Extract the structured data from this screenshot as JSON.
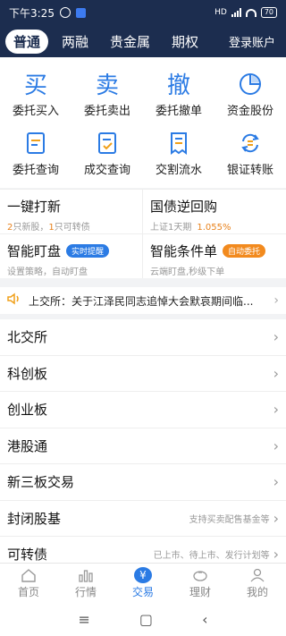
{
  "status": {
    "time": "下午3:25",
    "net": "HD",
    "battery": "70"
  },
  "nav": {
    "tabs": [
      "普通",
      "两融",
      "贵金属",
      "期权"
    ],
    "active": 0,
    "login": "登录账户"
  },
  "grid": [
    {
      "label": "委托买入",
      "glyph": "买",
      "icon": "buy-icon"
    },
    {
      "label": "委托卖出",
      "glyph": "卖",
      "icon": "sell-icon"
    },
    {
      "label": "委托撤单",
      "glyph": "撤",
      "icon": "cancel-order-icon"
    },
    {
      "label": "资金股份",
      "glyph": "",
      "icon": "pie-chart-icon"
    },
    {
      "label": "委托查询",
      "glyph": "",
      "icon": "order-query-icon"
    },
    {
      "label": "成交查询",
      "glyph": "",
      "icon": "trade-query-icon"
    },
    {
      "label": "交割流水",
      "glyph": "",
      "icon": "statement-icon"
    },
    {
      "label": "银证转账",
      "glyph": "",
      "icon": "transfer-icon"
    }
  ],
  "promo": {
    "ipo": {
      "title": "一键打新",
      "n1": "2",
      "t1": "只新股，",
      "n2": "1",
      "t2": "只可转债"
    },
    "repo": {
      "title": "国债逆回购",
      "sub": "上证1天期",
      "pct": "1.055%"
    },
    "watch": {
      "title": "智能盯盘",
      "tag": "实时提醒",
      "sub": "设置策略，自动盯盘"
    },
    "cond": {
      "title": "智能条件单",
      "tag": "自动委托",
      "sub": "云端盯盘,秒级下单"
    }
  },
  "notice": {
    "text": "上交所：关于江泽民同志追悼大会默哀期间临..."
  },
  "list": [
    {
      "label": "北交所",
      "extra": ""
    },
    {
      "label": "科创板",
      "extra": ""
    },
    {
      "label": "创业板",
      "extra": ""
    },
    {
      "label": "港股通",
      "extra": ""
    },
    {
      "label": "新三板交易",
      "extra": ""
    },
    {
      "label": "封闭股基",
      "extra": "支持买卖配售基金等"
    },
    {
      "label": "可转债",
      "extra": "已上市、待上市、发行计划等"
    }
  ],
  "bottom": [
    {
      "label": "首页",
      "icon": "home-icon"
    },
    {
      "label": "行情",
      "icon": "market-icon"
    },
    {
      "label": "交易",
      "icon": "trade-icon",
      "glyph": "¥"
    },
    {
      "label": "理财",
      "icon": "piggy-bank-icon"
    },
    {
      "label": "我的",
      "icon": "user-icon"
    }
  ],
  "colors": {
    "header": "#1c2d4f",
    "accent": "#2b7be4",
    "orange": "#f28a1e"
  }
}
